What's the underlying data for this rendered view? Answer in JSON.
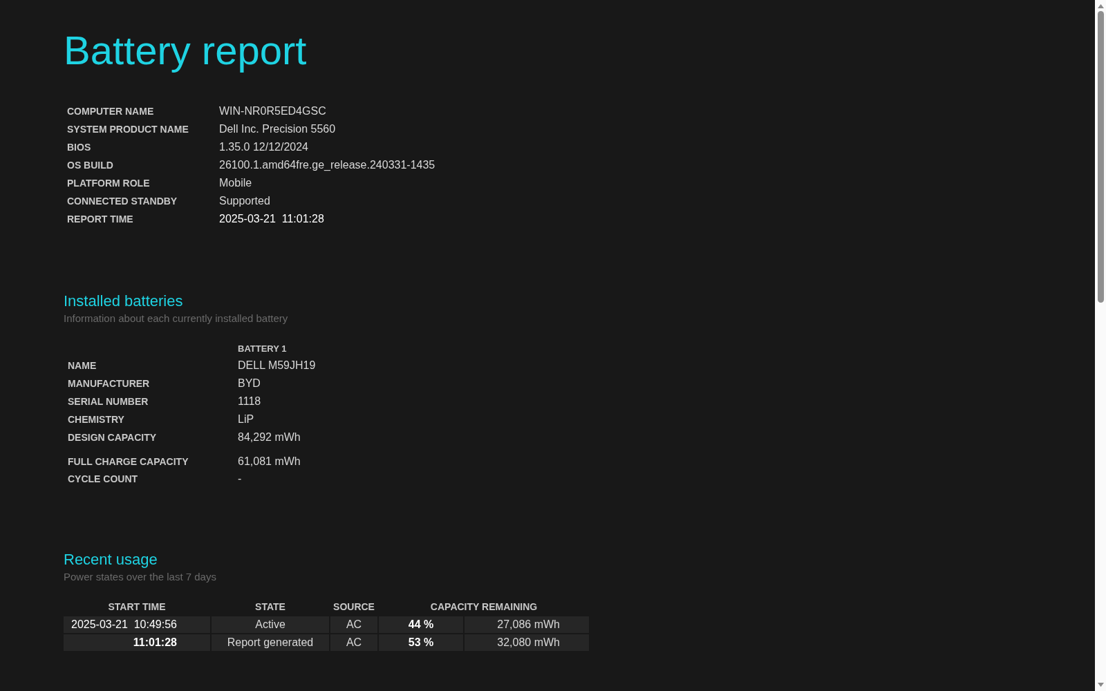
{
  "title": "Battery report",
  "system_info": [
    {
      "label": "COMPUTER NAME",
      "value": "WIN-NR0R5ED4GSC"
    },
    {
      "label": "SYSTEM PRODUCT NAME",
      "value": "Dell Inc. Precision 5560"
    },
    {
      "label": "BIOS",
      "value": "1.35.0 12/12/2024"
    },
    {
      "label": "OS BUILD",
      "value": "26100.1.amd64fre.ge_release.240331-1435"
    },
    {
      "label": "PLATFORM ROLE",
      "value": "Mobile"
    },
    {
      "label": "CONNECTED STANDBY",
      "value": "Supported"
    },
    {
      "label": "REPORT TIME",
      "value": "2025-03-21  11:01:28"
    }
  ],
  "installed_batteries": {
    "heading": "Installed batteries",
    "subtitle": "Information about each currently installed battery",
    "column": "BATTERY 1",
    "rows": [
      {
        "label": "NAME",
        "value": "DELL M59JH19"
      },
      {
        "label": "MANUFACTURER",
        "value": "BYD"
      },
      {
        "label": "SERIAL NUMBER",
        "value": "1118"
      },
      {
        "label": "CHEMISTRY",
        "value": "LiP"
      },
      {
        "label": "DESIGN CAPACITY",
        "value": "84,292 mWh"
      },
      {
        "label": "FULL CHARGE CAPACITY",
        "value": "61,081 mWh"
      },
      {
        "label": "CYCLE COUNT",
        "value": "-"
      }
    ]
  },
  "recent_usage": {
    "heading": "Recent usage",
    "subtitle": "Power states over the last 7 days",
    "columns": [
      "START TIME",
      "STATE",
      "SOURCE",
      "CAPACITY REMAINING"
    ],
    "rows": [
      {
        "date": "2025-03-21",
        "time": "10:49:56",
        "state": "Active",
        "source": "AC",
        "percent": "44 %",
        "capacity": "27,086 mWh"
      },
      {
        "time": "11:01:28",
        "state": "Report generated",
        "source": "AC",
        "percent": "53 %",
        "capacity": "32,080 mWh"
      }
    ]
  }
}
